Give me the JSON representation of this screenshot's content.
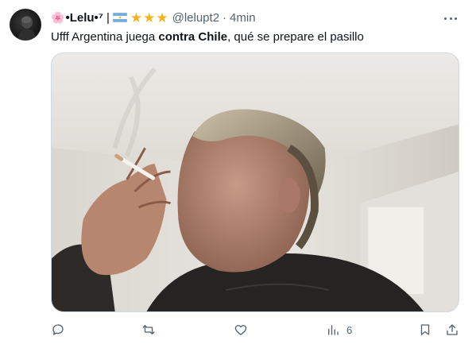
{
  "author": {
    "emoji": "🌸",
    "name": "•Lelu•⁷",
    "separator": "|",
    "stars": "★★★",
    "handle": "@lelupt2",
    "time": "4min"
  },
  "tweet": {
    "text_before": "Ufff Argentina juega ",
    "text_bold": "contra Chile",
    "text_after": ", qué se prepare el pasillo"
  },
  "actions": {
    "views_count": "6"
  },
  "colors": {
    "star": "#f2b31d",
    "muted": "#536471",
    "text": "#0f1419"
  }
}
